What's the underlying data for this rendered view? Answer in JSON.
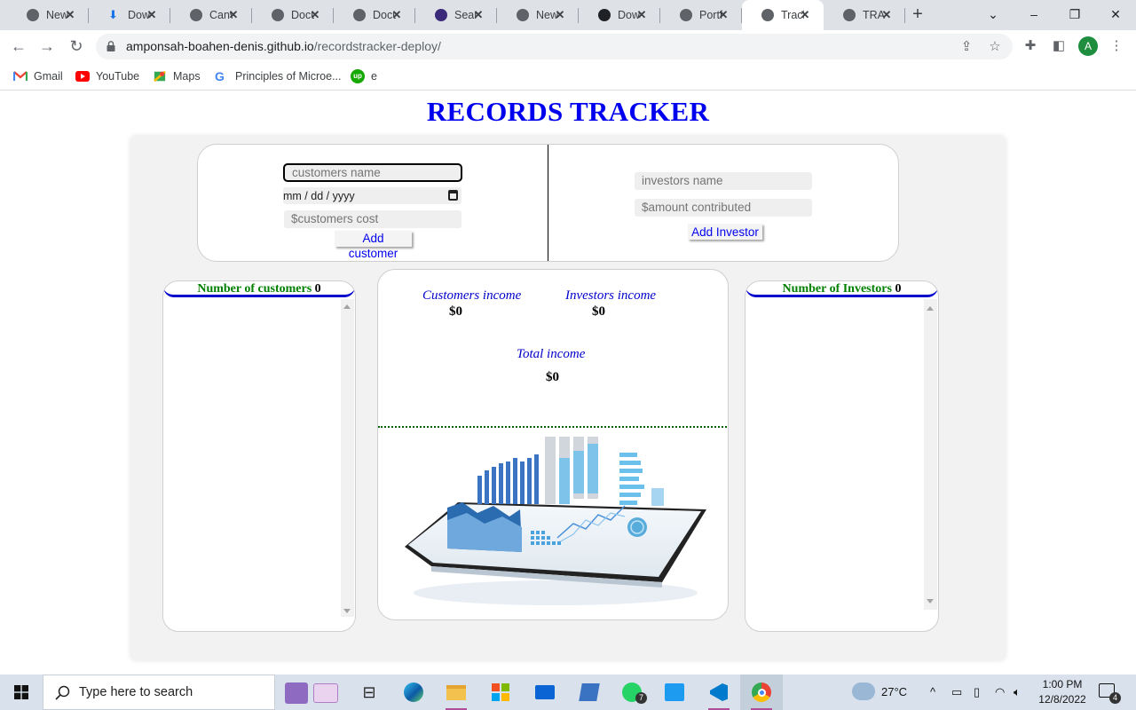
{
  "browser": {
    "tabs": [
      {
        "title": "New",
        "icon": "github-icon"
      },
      {
        "title": "Downloads",
        "icon": "download-icon"
      },
      {
        "title": "Canva",
        "icon": "globe-icon"
      },
      {
        "title": "Docu",
        "icon": "globe-icon"
      },
      {
        "title": "Docu",
        "icon": "globe-icon"
      },
      {
        "title": "Search",
        "icon": "search-app-icon"
      },
      {
        "title": "New",
        "icon": "github-icon"
      },
      {
        "title": "Down",
        "icon": "png-icon"
      },
      {
        "title": "Portfo",
        "icon": "globe-icon"
      },
      {
        "title": "Track",
        "icon": "globe-icon",
        "active": true
      },
      {
        "title": "TRAN",
        "icon": "globe-icon"
      }
    ],
    "url_host": "amponsah-boahen-denis.github.io",
    "url_path": "/recordstracker-deploy/",
    "profile_initial": "A",
    "bookmarks": [
      "Gmail",
      "YouTube",
      "Maps",
      "Principles of Microe...",
      "e"
    ]
  },
  "page": {
    "title": "RECORDS TRACKER",
    "customer_form": {
      "name_placeholder": "customers name",
      "date_placeholder": "mm / dd / yyyy",
      "cost_placeholder": "$customers cost",
      "add_label": "Add customer"
    },
    "investor_form": {
      "name_placeholder": "investors name",
      "amount_placeholder": "$amount contributed",
      "add_label": "Add Investor"
    },
    "customers_panel": {
      "label": "Number of customers",
      "count": "0"
    },
    "investors_panel": {
      "label": "Number of Investors",
      "count": "0"
    },
    "income": {
      "customers_label": "Customers income",
      "customers_value": "$0",
      "investors_label": "Investors income",
      "investors_value": "$0",
      "total_label": "Total income",
      "total_value": "$0"
    }
  },
  "taskbar": {
    "search_placeholder": "Type here to search",
    "weather": "27°C",
    "time": "1:00 PM",
    "date": "12/8/2022",
    "notifications": "4",
    "whatsapp_badge": "7"
  },
  "colors": {
    "title_blue": "#0000ee",
    "panel_head_green": "#008000",
    "dotted_green": "#006400"
  }
}
